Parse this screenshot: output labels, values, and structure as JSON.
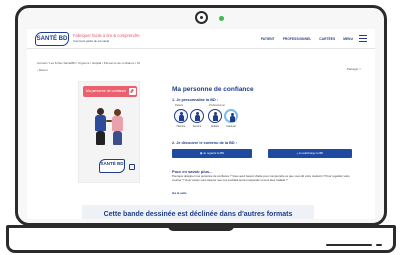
{
  "header": {
    "logo_text": "SANTÉ BD",
    "tagline": "Fabriquer facile à lire & comprendre",
    "subtagline": "Comment parler de ma santé",
    "nav": [
      "PATIENT",
      "PROFESSIONNEL",
      "CARTÉES",
      "MENU"
    ]
  },
  "breadcrumb": "Accueil / Les fiches SantéBD / Urgence / Hôpital / Personne de confiance / 01",
  "back_label": "‹ Retour",
  "share_label": "Partager",
  "cover": {
    "banner": "Ma personne de confiance",
    "logo_text": "SANTÉ BD"
  },
  "main": {
    "title": "Ma personne de confiance",
    "step1": "1. Je personnalise la BD :",
    "label_patient": "Patient",
    "label_professional": "Professionnel",
    "options": [
      "Homme",
      "Femme",
      "Enfant",
      "Fauteuil"
    ],
    "step2": "2. Je découvre le contenu de la BD :",
    "read_button": "Je regarde la BD",
    "download_button": "Je télécharge la BD",
    "more_title": "Pour en savoir plus...",
    "description": "Pourquoi désigner une personne de confiance ? Vous avez besoin d'aide pour comprendre ce que vous dit votre médecin ? Pour regarder votre courrier ? Vous voulez vous assurer que vos souhaits seront respectés si vous êtes malade ?",
    "read_more": "lire la suite"
  },
  "footer": {
    "title": "Cette bande dessinée est déclinée dans d'autres formats"
  },
  "colors": {
    "brand": "#1f3d8a",
    "accent": "#e9606f",
    "button": "#1f4aa0"
  }
}
